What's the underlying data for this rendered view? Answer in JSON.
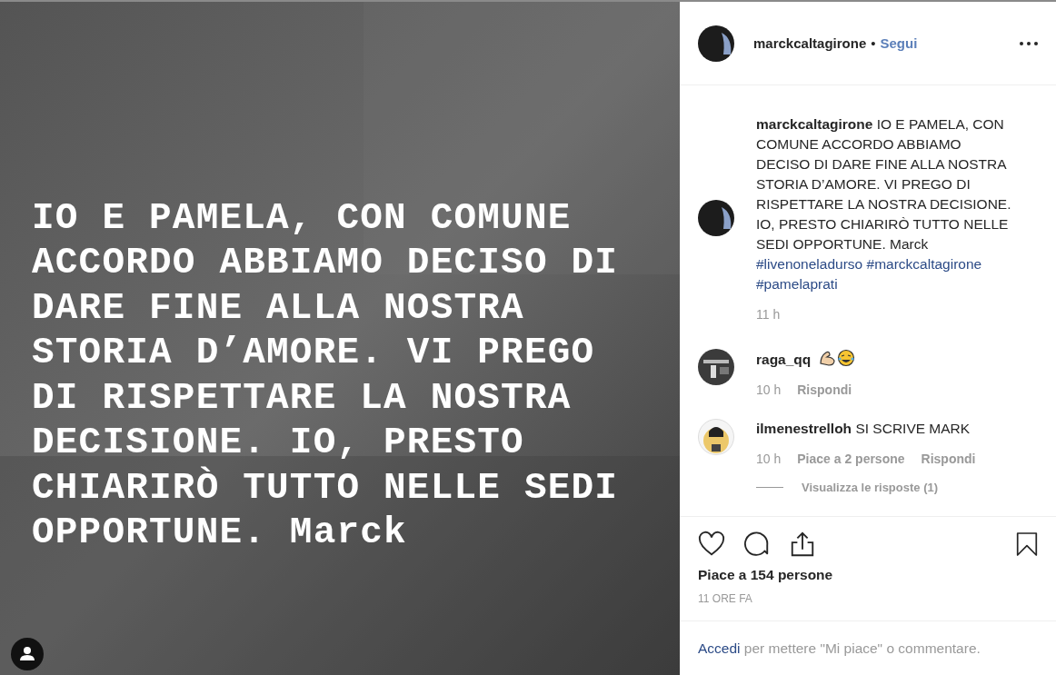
{
  "post_image": {
    "kind": "picture",
    "text": "IO E PAMELA, CON COMUNE ACCORDO ABBIAMO DECISO DI DARE FINE ALLA NOSTRA STORIA D’AMORE. VI PREGO DI RISPETTARE LA NOSTRA DECISIONE. IO, PRESTO CHIARIRÒ TUTTO NELLE SEDI OPPORTUNE. Marck"
  },
  "header": {
    "username": "marckcaltagirone",
    "separator": "•",
    "follow": "Segui"
  },
  "caption": {
    "username": "marckcaltagirone",
    "text": "IO E PAMELA, CON COMUNE ACCORDO ABBIAMO DECISO DI DARE FINE ALLA NOSTRA STORIA D’AMORE. VI PREGO DI RISPETTARE LA NOSTRA DECISIONE. IO, PRESTO CHIARIRÒ TUTTO NELLE SEDI OPPORTUNE. Marck",
    "hashtags": [
      "#livenoneladurso",
      "#marckcaltagirone",
      "#pamelaprati"
    ],
    "time": "11 h"
  },
  "comments": [
    {
      "username": "raga_qq",
      "emoji": true,
      "time": "10 h",
      "reply": "Rispondi"
    },
    {
      "username": "ilmenestrelloh",
      "text": "SI SCRIVE MARK",
      "emoji": false,
      "time": "10 h",
      "likes": "Piace a 2 persone",
      "reply": "Rispondi",
      "view_replies": "Visualizza le risposte (1)"
    }
  ],
  "likes": "Piace a 154 persone",
  "date": "11 ORE FA",
  "login": {
    "link": "Accedi",
    "text": "per mettere \"Mi piace\" o commentare."
  }
}
